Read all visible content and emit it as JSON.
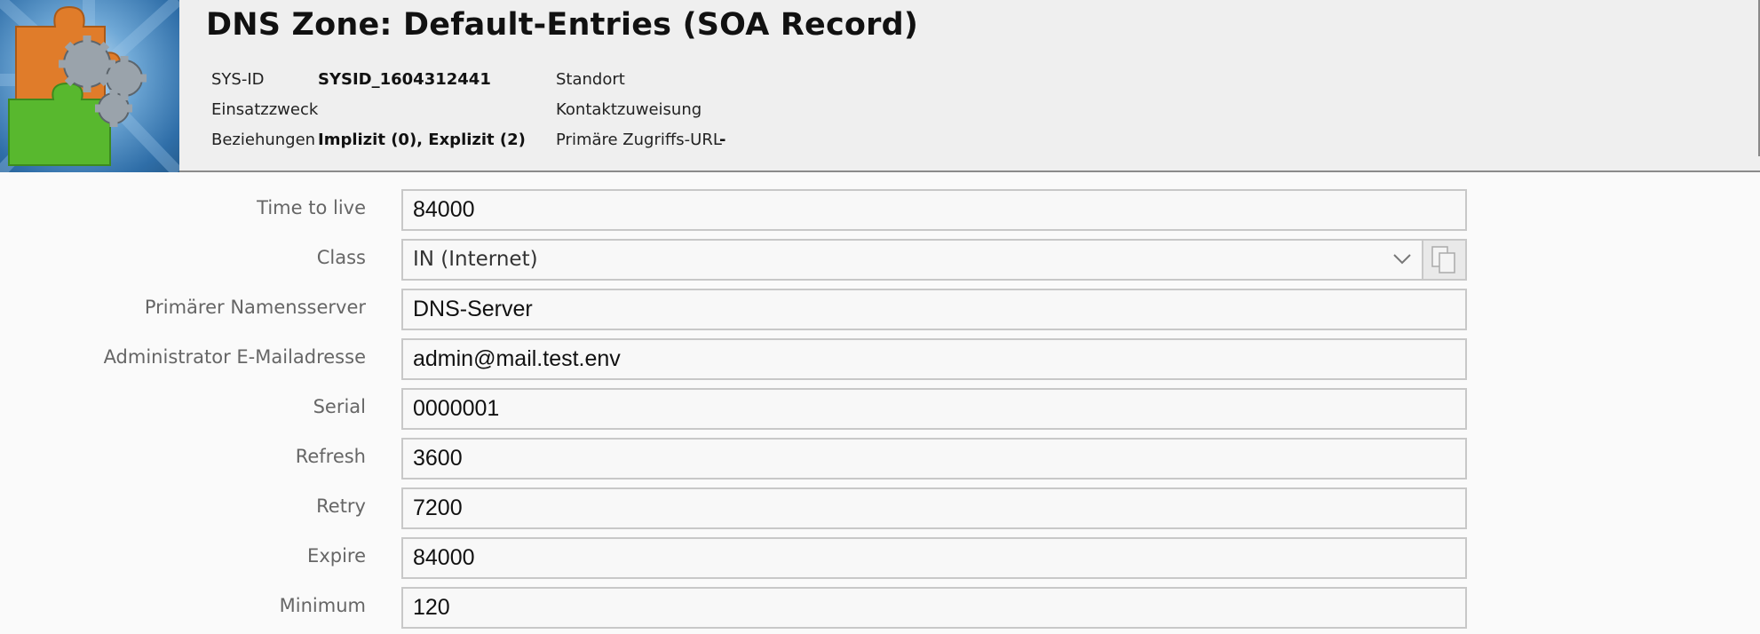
{
  "header": {
    "title": "DNS Zone: Default-Entries (SOA Record)",
    "meta": {
      "sysid_label": "SYS-ID",
      "sysid_value": "SYSID_1604312441",
      "standort_label": "Standort",
      "einsatzzweck_label": "Einsatzzweck",
      "kontakt_label": "Kontaktzuweisung",
      "beziehungen_label": "Beziehungen",
      "beziehungen_value": "Implizit (0), Explizit (2)",
      "url_label": "Primäre Zugriffs-URL",
      "url_value": "-"
    }
  },
  "form": {
    "ttl": {
      "label": "Time to live",
      "value": "84000"
    },
    "class": {
      "label": "Class",
      "value": "IN (Internet)"
    },
    "primary_ns": {
      "label": "Primärer Namensserver",
      "value": "DNS-Server"
    },
    "admin_email": {
      "label": "Administrator E-Mailadresse",
      "value": "admin@mail.test.env"
    },
    "serial": {
      "label": "Serial",
      "value": "0000001"
    },
    "refresh": {
      "label": "Refresh",
      "value": "3600"
    },
    "retry": {
      "label": "Retry",
      "value": "7200"
    },
    "expire": {
      "label": "Expire",
      "value": "84000"
    },
    "minimum": {
      "label": "Minimum",
      "value": "120"
    }
  },
  "icons": {
    "logo": "puzzle-gears-logo",
    "dropdown": "chevron-down-icon",
    "copy": "copy-icon"
  },
  "colors": {
    "header_bg": "#efefef",
    "logo_blue": "#2f6ea8",
    "puzzle_orange": "#e07c2a",
    "puzzle_green": "#58b82e"
  }
}
